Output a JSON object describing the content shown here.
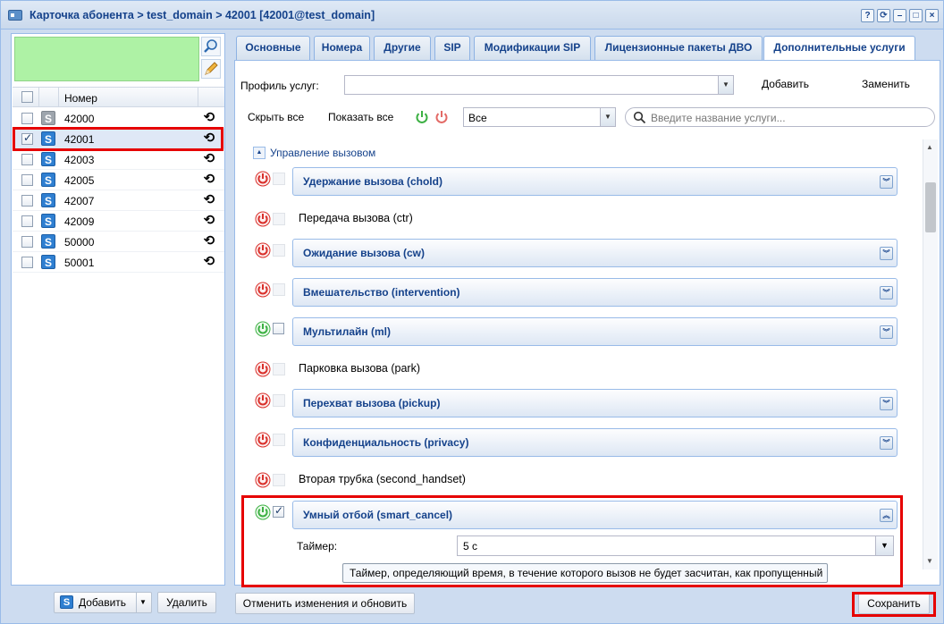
{
  "window": {
    "title": "Карточка абонента > test_domain > 42001 [42001@test_domain]",
    "tools": [
      "?",
      "⟳",
      "–",
      "□",
      "×"
    ]
  },
  "subscribers": {
    "header": "Номер",
    "rows": [
      {
        "number": "42000",
        "checked": false,
        "icon_color": "grey"
      },
      {
        "number": "42001",
        "checked": true,
        "icon_color": "blue"
      },
      {
        "number": "42003",
        "checked": false,
        "icon_color": "blue"
      },
      {
        "number": "42005",
        "checked": false,
        "icon_color": "blue"
      },
      {
        "number": "42007",
        "checked": false,
        "icon_color": "blue"
      },
      {
        "number": "42009",
        "checked": false,
        "icon_color": "blue"
      },
      {
        "number": "50000",
        "checked": false,
        "icon_color": "blue"
      },
      {
        "number": "50001",
        "checked": false,
        "icon_color": "blue"
      }
    ],
    "s_glyph": "S",
    "history_glyph": "⟲",
    "add_label": "Добавить",
    "delete_label": "Удалить"
  },
  "tabs": [
    {
      "label": "Основные",
      "active": false
    },
    {
      "label": "Номера",
      "active": false
    },
    {
      "label": "Другие",
      "active": false
    },
    {
      "label": "SIP",
      "active": false
    },
    {
      "label": "Модификации SIP",
      "active": false
    },
    {
      "label": "Лицензионные пакеты ДВО",
      "active": false
    },
    {
      "label": "Дополнительные услуги",
      "active": true
    }
  ],
  "profile": {
    "label": "Профиль услуг:",
    "value": "",
    "add_label": "Добавить",
    "replace_label": "Заменить"
  },
  "filters": {
    "collapse_all": "Скрыть все",
    "show_all": "Показать все",
    "filter_value": "Все",
    "search_placeholder": "Введите название услуги..."
  },
  "group": {
    "title": "Управление вызовом"
  },
  "services": [
    {
      "title": "Удержание вызова (chold)",
      "expandable": true,
      "enabled": false,
      "checked": false
    },
    {
      "title": "Передача вызова (ctr)",
      "expandable": false,
      "enabled": false,
      "checked": false
    },
    {
      "title": "Ожидание вызова (cw)",
      "expandable": true,
      "enabled": false,
      "checked": false
    },
    {
      "title": "Вмешательство (intervention)",
      "expandable": true,
      "enabled": false,
      "checked": false
    },
    {
      "title": "Мультилайн (ml)",
      "expandable": true,
      "enabled": true,
      "checked": false
    },
    {
      "title": "Парковка вызова (park)",
      "expandable": false,
      "enabled": false,
      "checked": false
    },
    {
      "title": "Перехват вызова (pickup)",
      "expandable": true,
      "enabled": false,
      "checked": false
    },
    {
      "title": "Конфиденциальность (privacy)",
      "expandable": true,
      "enabled": false,
      "checked": false
    },
    {
      "title": "Вторая трубка (second_handset)",
      "expandable": false,
      "enabled": false,
      "checked": false
    },
    {
      "title": "Умный отбой (smart_cancel)",
      "expandable": true,
      "expanded": true,
      "enabled": true,
      "checked": true
    }
  ],
  "smart_cancel": {
    "timer_label": "Таймер:",
    "timer_value": "5 с",
    "tooltip": "Таймер, определяющий время, в течение которого вызов не будет засчитан, как пропущенный"
  },
  "footer": {
    "revert_label": "Отменить изменения и обновить",
    "save_label": "Сохранить"
  },
  "colors": {
    "power_on": "#3cb043",
    "power_off": "#d9302b",
    "highlight": "#e60000",
    "title_text": "#15428b"
  }
}
